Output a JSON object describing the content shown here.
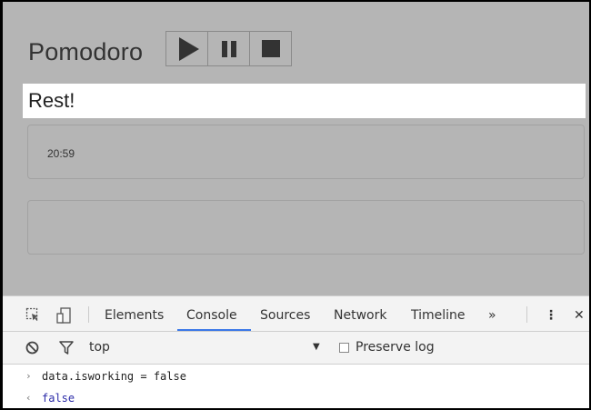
{
  "app": {
    "title": "Pomodoro",
    "status": "Rest!",
    "timer": "20:59",
    "controls": [
      "play-icon",
      "pause-icon",
      "stop-icon"
    ]
  },
  "devtools": {
    "tabs": [
      "Elements",
      "Console",
      "Sources",
      "Network",
      "Timeline"
    ],
    "active_tab": "Console",
    "more_glyph": "»",
    "menu_glyph": "⋮",
    "close_glyph": "✕",
    "context": "top",
    "preserve_log_label": "Preserve log",
    "console": {
      "input_prompt": "›",
      "input": "data.isworking = false",
      "output_prompt": "‹",
      "output": "false"
    },
    "accent_color": "#3b78e7"
  }
}
